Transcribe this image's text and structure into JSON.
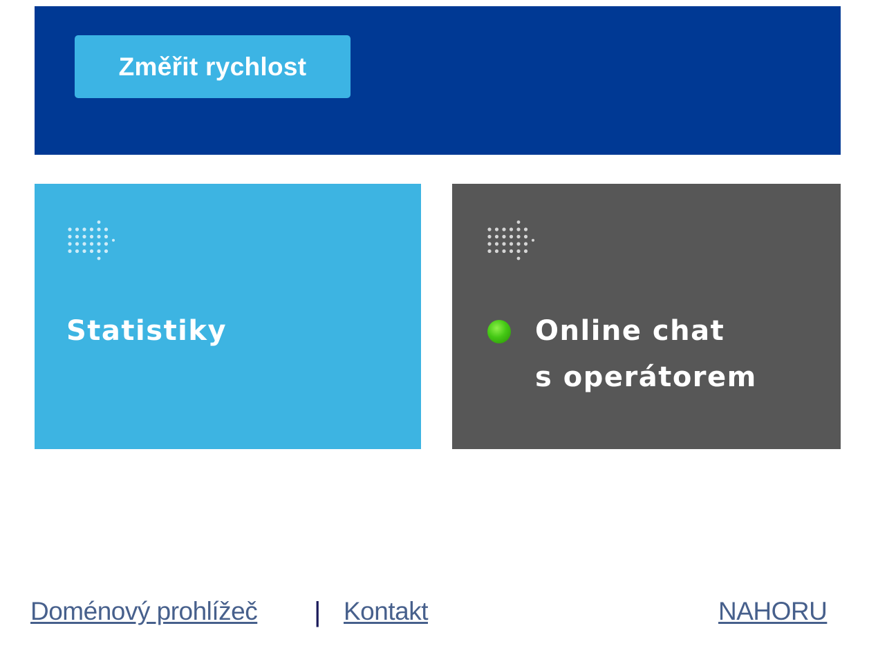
{
  "banner": {
    "speed_button_label": "Změřit rychlost"
  },
  "tiles": [
    {
      "title": "Statistiky",
      "icon": "dots-arrow-icon",
      "background": "#3db4e2"
    },
    {
      "title_line1": "Online chat",
      "title_line2": "s operátorem",
      "icon": "dots-arrow-icon",
      "status_icon": "online-status-dot",
      "status_color": "#44c814",
      "background": "#575757"
    }
  ],
  "footer": {
    "links": [
      {
        "label": "Doménový prohlížeč"
      },
      {
        "label": "Kontakt"
      }
    ],
    "separator": "|",
    "top_link": "NAHORU"
  },
  "colors": {
    "banner": "#003994",
    "button": "#3cb4e4",
    "link": "#47608c"
  }
}
